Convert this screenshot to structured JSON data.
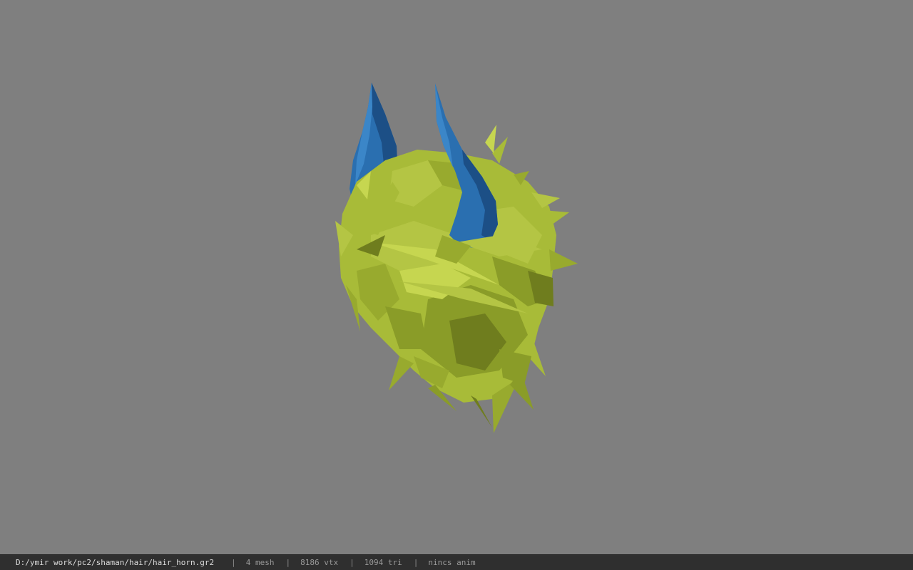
{
  "viewer": {
    "background_color": "#7f7f7f",
    "model": {
      "hair_color": "#a8bb38",
      "hair_shadow_color": "#6f7d1e",
      "hair_highlight_color": "#c6d650",
      "horn_color": "#2a6fb0",
      "horn_shadow_color": "#1c4f86",
      "horn_highlight_color": "#3b86c8"
    }
  },
  "status_bar": {
    "file_path": "D:/ymir work/pc2/shaman/hair/hair_horn.gr2",
    "separator": "|",
    "mesh_count": "4 mesh",
    "vertex_count": "8186 vtx",
    "triangle_count": "1094 tri",
    "anim_status": "nincs anim"
  }
}
